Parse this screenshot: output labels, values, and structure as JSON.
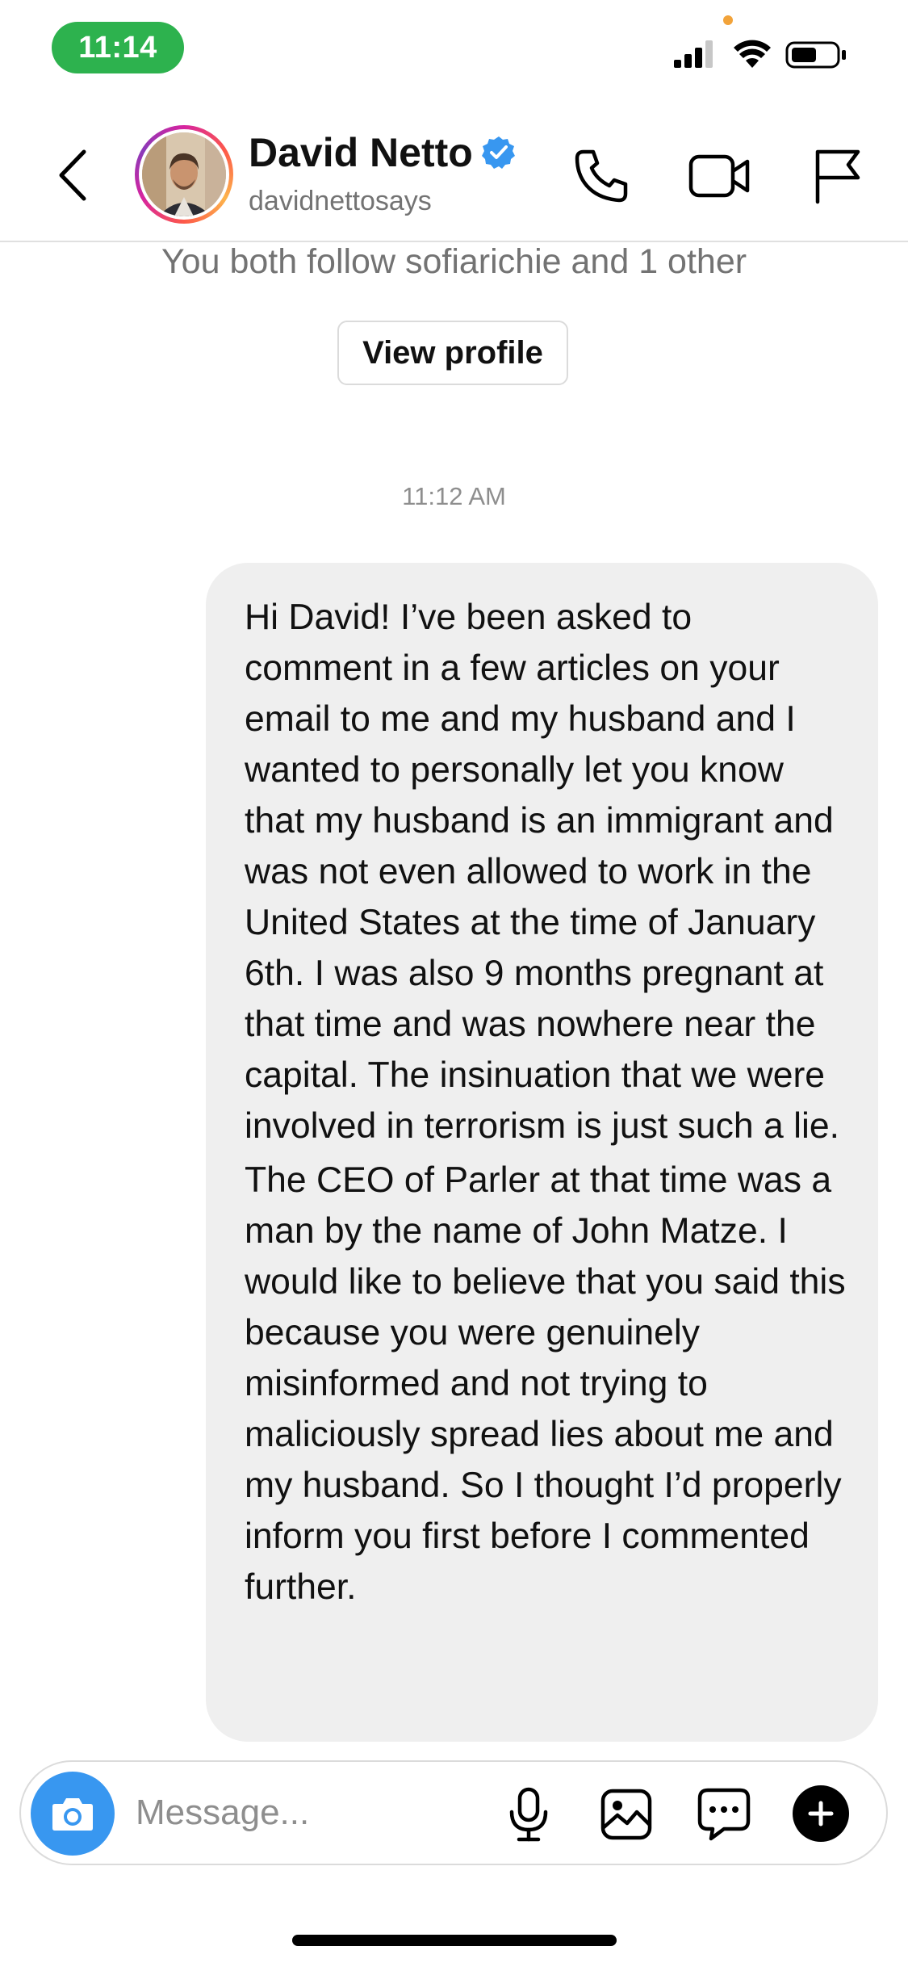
{
  "status_bar": {
    "time": "11:14"
  },
  "header": {
    "name": "David Netto",
    "username": "davidnettosays",
    "icons": [
      "back-chevron-icon",
      "verified-badge-icon",
      "phone-icon",
      "video-camera-icon",
      "flag-icon"
    ]
  },
  "thread": {
    "mutual_followers": "You both follow sofiarichie and 1 other",
    "view_profile_label": "View profile",
    "timestamp": "11:12 AM",
    "message": {
      "paragraph_1": "Hi David! I’ve been asked to comment in a few articles on your email to me and my husband and I wanted to personally let you know that my husband is an immigrant and was not even allowed to work in the United States at the time of January 6th. I was also 9 months pregnant at that time and was nowhere near the capital. The insinuation that we were involved in terrorism is just such a lie.",
      "paragraph_2": "The CEO of Parler at that time was a man by the name of John Matze. I would like to believe that you said this because you were genuinely misinformed and not trying to maliciously spread lies about me and my husband. So I thought I’d properly inform you first before I commented further."
    },
    "bubble_color": "#efefef"
  },
  "composer": {
    "placeholder": "Message...",
    "value": "",
    "camera_color": "#3897f0",
    "icons": [
      "camera-icon",
      "microphone-icon",
      "gallery-icon",
      "sticker-chat-icon",
      "plus-icon"
    ]
  },
  "colors": {
    "status_pill": "#2db24e",
    "verified": "#3897f0",
    "secondary_text": "#737373"
  }
}
